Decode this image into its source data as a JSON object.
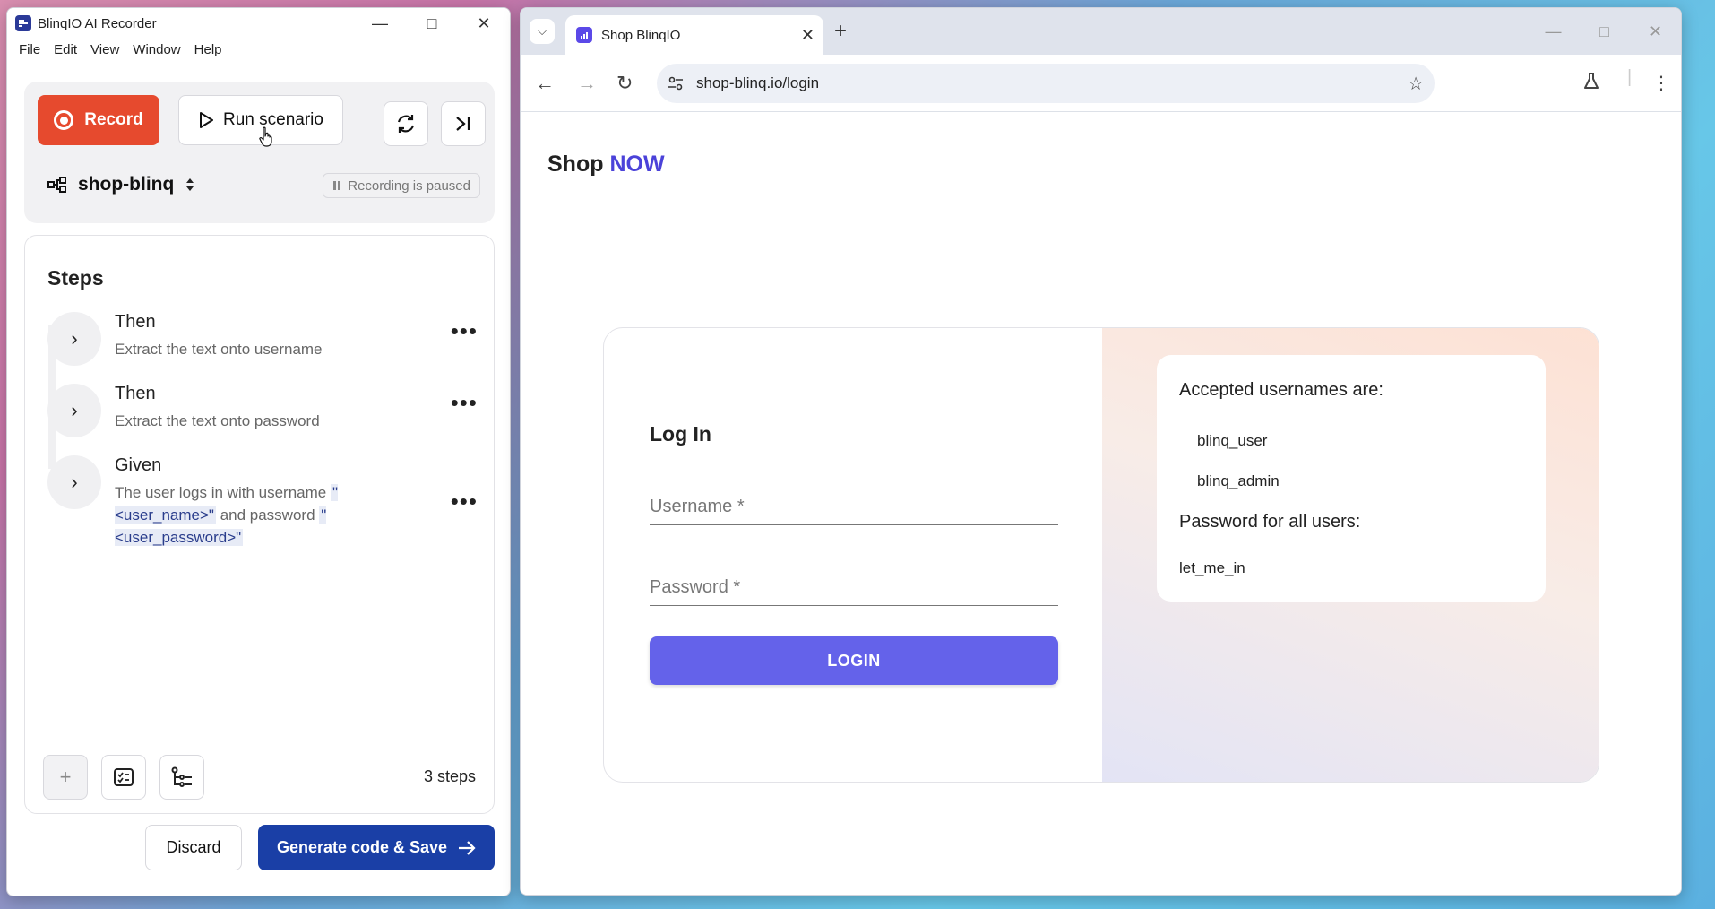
{
  "recorder": {
    "title": "BlinqIO AI Recorder",
    "menu": [
      "File",
      "Edit",
      "View",
      "Window",
      "Help"
    ],
    "record_label": "Record",
    "run_label": "Run scenario",
    "project_name": "shop-blinq",
    "status": "Recording is paused",
    "steps_heading": "Steps",
    "steps": [
      {
        "keyword": "Then",
        "text": "Extract the text onto username"
      },
      {
        "keyword": "Then",
        "text": "Extract the text onto password"
      },
      {
        "keyword": "Given",
        "text_a": "The user logs in with username",
        "param1": "\"<user_name>\"",
        "text_b": "and password",
        "param2": "\"<user_password>\""
      }
    ],
    "step_count": "3 steps",
    "discard_label": "Discard",
    "generate_label": "Generate code & Save",
    "colors": {
      "record": "#e64a2e",
      "generate": "#1a3fa6"
    }
  },
  "browser": {
    "tab_title": "Shop BlinqIO",
    "url": "shop-blinq.io/login",
    "page": {
      "logo_shop": "Shop",
      "logo_now": "NOW",
      "login_heading": "Log In",
      "username_label": "Username *",
      "password_label": "Password *",
      "login_button": "LOGIN",
      "accepted_heading": "Accepted usernames are:",
      "usernames": [
        "blinq_user",
        "blinq_admin"
      ],
      "password_heading": "Password for all users:",
      "password_value": "let_me_in",
      "colors": {
        "accent": "#4b42d9",
        "button": "#6462ea"
      }
    }
  }
}
